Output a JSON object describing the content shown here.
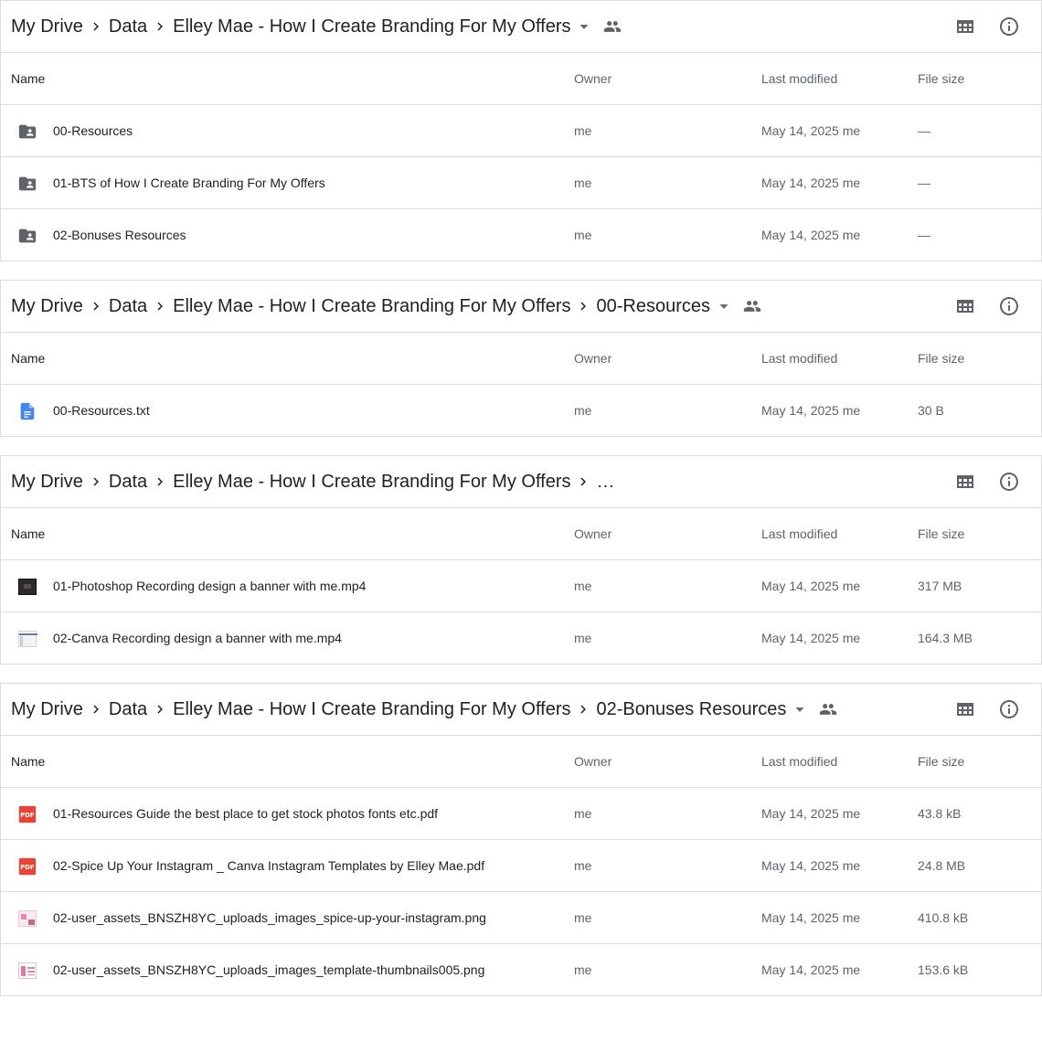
{
  "columns": {
    "name": "Name",
    "owner": "Owner",
    "modified": "Last modified",
    "size": "File size"
  },
  "colors": {
    "folder": "#5f6368",
    "doc": "#4285f4",
    "pdf": "#ea4335",
    "border": "#dadce0",
    "muted": "#5f6368"
  },
  "panels": [
    {
      "breadcrumb": [
        "My Drive",
        "Data",
        "Elley Mae - How I Create Branding For My Offers"
      ],
      "has_caret": true,
      "shared_icon": "people-icon",
      "rows": [
        {
          "icon": "shared-folder-icon",
          "name": "00-Resources",
          "owner": "me",
          "modified": "May 14, 2025 me",
          "size": "—"
        },
        {
          "icon": "shared-folder-icon",
          "name": "01-BTS of How I Create Branding For My Offers",
          "owner": "me",
          "modified": "May 14, 2025 me",
          "size": "—"
        },
        {
          "icon": "shared-folder-icon",
          "name": "02-Bonuses Resources",
          "owner": "me",
          "modified": "May 14, 2025 me",
          "size": "—"
        }
      ]
    },
    {
      "breadcrumb": [
        "My Drive",
        "Data",
        "Elley Mae - How I Create Branding For My Offers",
        "00-Resources"
      ],
      "has_caret": true,
      "shared_icon": "people-icon",
      "rows": [
        {
          "icon": "doc-icon",
          "name": "00-Resources.txt",
          "owner": "me",
          "modified": "May 14, 2025 me",
          "size": "30 B"
        }
      ]
    },
    {
      "breadcrumb": [
        "My Drive",
        "Data",
        "Elley Mae - How I Create Branding For My Offers",
        "…"
      ],
      "has_caret": false,
      "shared_icon": "",
      "rows": [
        {
          "icon": "video-thumbnail-icon",
          "name": "01-Photoshop Recording design a banner with me.mp4",
          "owner": "me",
          "modified": "May 14, 2025 me",
          "size": "317 MB"
        },
        {
          "icon": "video-thumbnail-icon",
          "name": "02-Canva Recording design a banner with me.mp4",
          "owner": "me",
          "modified": "May 14, 2025 me",
          "size": "164.3 MB"
        }
      ]
    },
    {
      "breadcrumb": [
        "My Drive",
        "Data",
        "Elley Mae - How I Create Branding For My Offers",
        "02-Bonuses Resources"
      ],
      "has_caret": true,
      "shared_icon": "people-icon",
      "rows": [
        {
          "icon": "pdf-icon",
          "name": "01-Resources Guide the best place to get stock photos fonts etc.pdf",
          "owner": "me",
          "modified": "May 14, 2025 me",
          "size": "43.8 kB"
        },
        {
          "icon": "pdf-icon",
          "name": "02-Spice Up Your Instagram _ Canva Instagram Templates by Elley Mae.pdf",
          "owner": "me",
          "modified": "May 14, 2025 me",
          "size": "24.8 MB"
        },
        {
          "icon": "image-thumbnail-icon",
          "name": "02-user_assets_BNSZH8YC_uploads_images_spice-up-your-instagram.png",
          "owner": "me",
          "modified": "May 14, 2025 me",
          "size": "410.8 kB"
        },
        {
          "icon": "image-thumbnail-icon",
          "name": "02-user_assets_BNSZH8YC_uploads_images_template-thumbnails005.png",
          "owner": "me",
          "modified": "May 14, 2025 me",
          "size": "153.6 kB"
        }
      ]
    }
  ]
}
